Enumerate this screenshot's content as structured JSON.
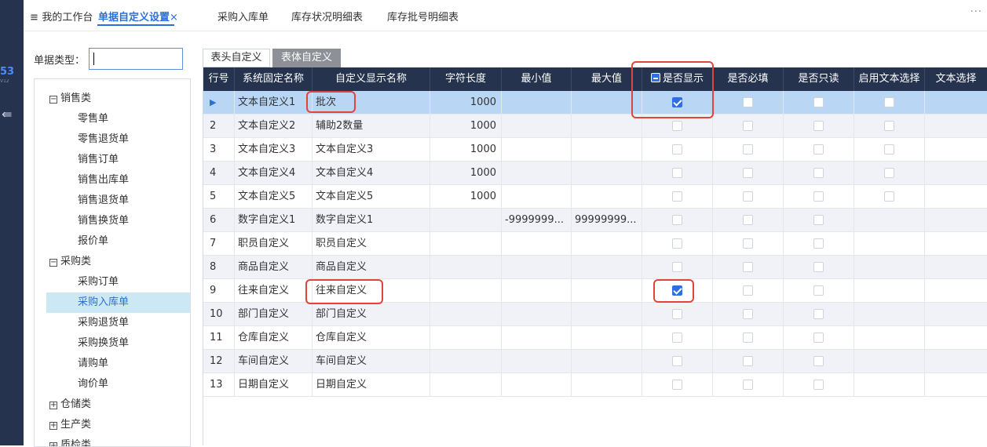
{
  "rail": {
    "badge": "53",
    "sub": "V12",
    "menu_icon": "menu-collapse-icon"
  },
  "tabs": [
    {
      "label": "我的工作台",
      "icon": "menu-icon"
    },
    {
      "label": "单据自定义设置",
      "active": true,
      "close": "×"
    },
    {
      "label": "采购入库单"
    },
    {
      "label": "库存状况明细表"
    },
    {
      "label": "库存批号明细表"
    }
  ],
  "more": "···",
  "filter": {
    "label": "单据类型：",
    "value": ""
  },
  "tree": {
    "categories": [
      {
        "label": "销售类",
        "expanded": true,
        "sign": "−",
        "children": [
          "零售单",
          "零售退货单",
          "销售订单",
          "销售出库单",
          "销售退货单",
          "销售换货单",
          "报价单"
        ]
      },
      {
        "label": "采购类",
        "expanded": true,
        "sign": "−",
        "children": [
          "采购订单",
          "采购入库单",
          "采购退货单",
          "采购换货单",
          "请购单",
          "询价单"
        ]
      },
      {
        "label": "仓储类",
        "expanded": false,
        "sign": "+",
        "children": []
      },
      {
        "label": "生产类",
        "expanded": false,
        "sign": "+",
        "children": []
      },
      {
        "label": "质检类",
        "expanded": false,
        "sign": "+",
        "children": []
      }
    ],
    "selected": "采购入库单"
  },
  "subtabs": {
    "head": "表头自定义",
    "body": "表体自定义",
    "active": "body"
  },
  "grid": {
    "columns": [
      "行号",
      "系统固定名称",
      "自定义显示名称",
      "字符长度",
      "最小值",
      "最大值",
      "是否显示",
      "是否必填",
      "是否只读",
      "启用文本选择",
      "文本选择"
    ],
    "rows": [
      {
        "no": "1",
        "sys": "文本自定义1",
        "custom": "批次",
        "len": "1000",
        "min": "",
        "max": "",
        "show": true,
        "req": false,
        "ro": false,
        "txtsel": false,
        "selected": true
      },
      {
        "no": "2",
        "sys": "文本自定义2",
        "custom": "辅助2数量",
        "len": "1000",
        "min": "",
        "max": "",
        "show": false,
        "req": false,
        "ro": false,
        "txtsel": false
      },
      {
        "no": "3",
        "sys": "文本自定义3",
        "custom": "文本自定义3",
        "len": "1000",
        "min": "",
        "max": "",
        "show": false,
        "req": false,
        "ro": false,
        "txtsel": false
      },
      {
        "no": "4",
        "sys": "文本自定义4",
        "custom": "文本自定义4",
        "len": "1000",
        "min": "",
        "max": "",
        "show": false,
        "req": false,
        "ro": false,
        "txtsel": false
      },
      {
        "no": "5",
        "sys": "文本自定义5",
        "custom": "文本自定义5",
        "len": "1000",
        "min": "",
        "max": "",
        "show": false,
        "req": false,
        "ro": false,
        "txtsel": false
      },
      {
        "no": "6",
        "sys": "数字自定义1",
        "custom": "数字自定义1",
        "len": "",
        "min": "-9999999...",
        "max": "99999999...",
        "show": false,
        "req": false,
        "ro": false
      },
      {
        "no": "7",
        "sys": "职员自定义",
        "custom": "职员自定义",
        "len": "",
        "min": "",
        "max": "",
        "show": false,
        "req": false,
        "ro": false
      },
      {
        "no": "8",
        "sys": "商品自定义",
        "custom": "商品自定义",
        "len": "",
        "min": "",
        "max": "",
        "show": false,
        "req": false,
        "ro": false
      },
      {
        "no": "9",
        "sys": "往来自定义",
        "custom": "往来自定义",
        "len": "",
        "min": "",
        "max": "",
        "show": true,
        "req": false,
        "ro": false
      },
      {
        "no": "10",
        "sys": "部门自定义",
        "custom": "部门自定义",
        "len": "",
        "min": "",
        "max": "",
        "show": false,
        "req": false,
        "ro": false
      },
      {
        "no": "11",
        "sys": "仓库自定义",
        "custom": "仓库自定义",
        "len": "",
        "min": "",
        "max": "",
        "show": false,
        "req": false,
        "ro": false
      },
      {
        "no": "12",
        "sys": "车间自定义",
        "custom": "车间自定义",
        "len": "",
        "min": "",
        "max": "",
        "show": false,
        "req": false,
        "ro": false
      },
      {
        "no": "13",
        "sys": "日期自定义",
        "custom": "日期自定义",
        "len": "",
        "min": "",
        "max": "",
        "show": false,
        "req": false,
        "ro": false
      }
    ],
    "current_row_marker": "▶"
  },
  "colors": {
    "accent": "#2b6fd8",
    "header_bg": "#26334f",
    "selected_row": "#b9d7f4",
    "highlight": "#e0443a"
  }
}
